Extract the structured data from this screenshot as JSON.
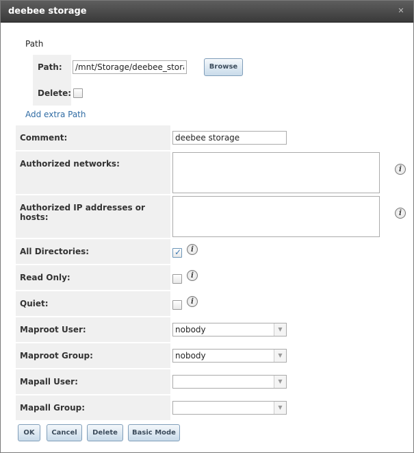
{
  "dialog": {
    "title": "deebee storage",
    "close_glyph": "✕"
  },
  "path_section": {
    "heading": "Path",
    "path_label": "Path:",
    "path_value": "/mnt/Storage/deebee_storage",
    "browse_label": "Browse",
    "delete_label": "Delete:",
    "delete_checked": false,
    "add_extra_path": "Add extra Path"
  },
  "form": {
    "comment_label": "Comment:",
    "comment_value": "deebee storage",
    "networks_label": "Authorized networks:",
    "networks_value": "",
    "hosts_label": "Authorized IP addresses or hosts:",
    "hosts_value": "",
    "all_dirs_label": "All Directories:",
    "all_dirs_checked": true,
    "read_only_label": "Read Only:",
    "read_only_checked": false,
    "quiet_label": "Quiet:",
    "quiet_checked": false,
    "maproot_user_label": "Maproot User:",
    "maproot_user_value": "nobody",
    "maproot_group_label": "Maproot Group:",
    "maproot_group_value": "nobody",
    "mapall_user_label": "Mapall User:",
    "mapall_user_value": "",
    "mapall_group_label": "Mapall Group:",
    "mapall_group_value": ""
  },
  "info_icon_glyph": "i",
  "check_glyph": "✓",
  "select_arrow_glyph": "▼",
  "buttons": {
    "ok": "OK",
    "cancel": "Cancel",
    "delete": "Delete",
    "basic_mode": "Basic Mode"
  },
  "colors": {
    "titlebar": "#4a4a4a",
    "label_bg": "#f0f0f0",
    "button_border": "#7f9db9",
    "link": "#2f6ba3"
  }
}
